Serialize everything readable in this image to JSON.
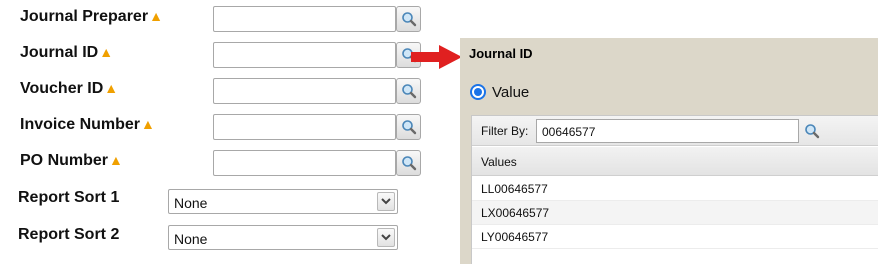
{
  "form": {
    "fields": [
      {
        "label": "Journal Preparer",
        "value": ""
      },
      {
        "label": "Journal ID",
        "value": ""
      },
      {
        "label": "Voucher ID",
        "value": ""
      },
      {
        "label": "Invoice Number",
        "value": ""
      },
      {
        "label": "PO Number",
        "value": ""
      }
    ],
    "required_marker": "▲",
    "sorts": [
      {
        "label": "Report Sort 1",
        "value": "None"
      },
      {
        "label": "Report Sort 2",
        "value": "None"
      }
    ]
  },
  "lookup": {
    "title": "Journal ID",
    "radio_label": "Value",
    "filter_label": "Filter By:",
    "filter_value": "00646577",
    "column_header": "Values",
    "rows": [
      "LL00646577",
      "LX00646577",
      "LY00646577"
    ]
  },
  "colors": {
    "required_marker": "#f0a000",
    "panel_bg": "#dcd7c9",
    "callout_arrow": "#e02020",
    "radio": "#1a73e8"
  }
}
